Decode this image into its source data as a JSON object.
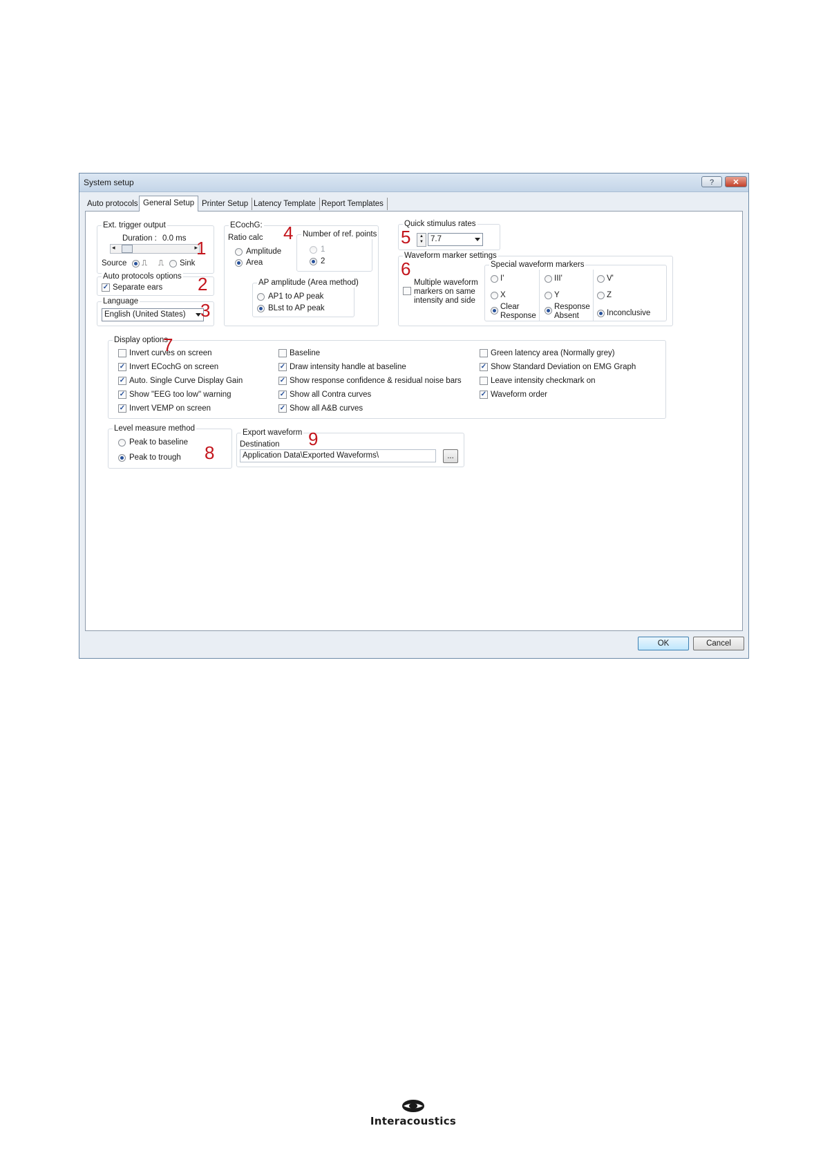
{
  "window": {
    "title": "System setup",
    "help_label": "?",
    "close_label": "✕"
  },
  "tabs": [
    {
      "label": "Auto protocols"
    },
    {
      "label": "General Setup"
    },
    {
      "label": "Printer Setup"
    },
    {
      "label": "Latency Template"
    },
    {
      "label": "Report Templates"
    }
  ],
  "trigger": {
    "title": "Ext. trigger output",
    "duration_label": "Duration :",
    "duration_value": "0.0 ms",
    "source_label": "Source",
    "sink_label": "Sink",
    "marker": "1"
  },
  "auto_protocols": {
    "title": "Auto protocols options",
    "separate_ears": "Separate ears",
    "marker": "2"
  },
  "language": {
    "title": "Language",
    "value": "English (United States)",
    "marker": "3"
  },
  "ecochg": {
    "title": "ECochG:",
    "ratio_title": "Ratio calc",
    "amplitude": "Amplitude",
    "area": "Area",
    "refpoints_title": "Number of ref. points",
    "ref1": "1",
    "ref2": "2",
    "ap_title": "AP amplitude (Area method)",
    "ap1": "AP1 to AP peak",
    "ap2": "BLst to AP peak",
    "marker": "4"
  },
  "quick_rates": {
    "title": "Quick stimulus rates",
    "value": "7.7",
    "marker": "5"
  },
  "waveform_markers": {
    "title": "Waveform marker settings",
    "multiple_label_1": "Multiple waveform",
    "multiple_label_2": "markers on same",
    "multiple_label_3": "intensity and side",
    "special_title": "Special waveform markers",
    "i_prime": "I'",
    "iii_prime": "III'",
    "v_prime": "V'",
    "x": "X",
    "y": "Y",
    "z": "Z",
    "clear_1": "Clear",
    "clear_2": "Response",
    "absent_1": "Response",
    "absent_2": "Absent",
    "inconclusive": "Inconclusive",
    "marker": "6"
  },
  "display": {
    "title": "Display options",
    "marker": "7",
    "col1": [
      {
        "label": "Invert curves on screen",
        "checked": false
      },
      {
        "label": "Invert ECochG on screen",
        "checked": true
      },
      {
        "label": "Auto. Single Curve Display Gain",
        "checked": true
      },
      {
        "label": "Show \"EEG too low\" warning",
        "checked": true
      },
      {
        "label": "Invert VEMP on screen",
        "checked": true
      }
    ],
    "col2": [
      {
        "label": "Baseline",
        "checked": false
      },
      {
        "label": "Draw intensity handle at baseline",
        "checked": true
      },
      {
        "label": "Show response confidence & residual noise bars",
        "checked": true
      },
      {
        "label": "Show all Contra curves",
        "checked": true
      },
      {
        "label": "Show all A&B curves",
        "checked": true
      }
    ],
    "col3": [
      {
        "label": "Green latency area (Normally grey)",
        "checked": false
      },
      {
        "label": "Show Standard Deviation on EMG Graph",
        "checked": true
      },
      {
        "label": "Leave intensity checkmark on",
        "checked": false
      },
      {
        "label": "Waveform order",
        "checked": true
      }
    ]
  },
  "level": {
    "title": "Level measure method",
    "baseline": "Peak to baseline",
    "trough": "Peak to trough",
    "marker": "8"
  },
  "export": {
    "title": "Export waveform",
    "destination_label": "Destination",
    "path": "Application Data\\Exported Waveforms\\",
    "browse": "...",
    "marker": "9"
  },
  "buttons": {
    "ok": "OK",
    "cancel": "Cancel"
  },
  "footer": {
    "brand": "Interacoustics"
  }
}
